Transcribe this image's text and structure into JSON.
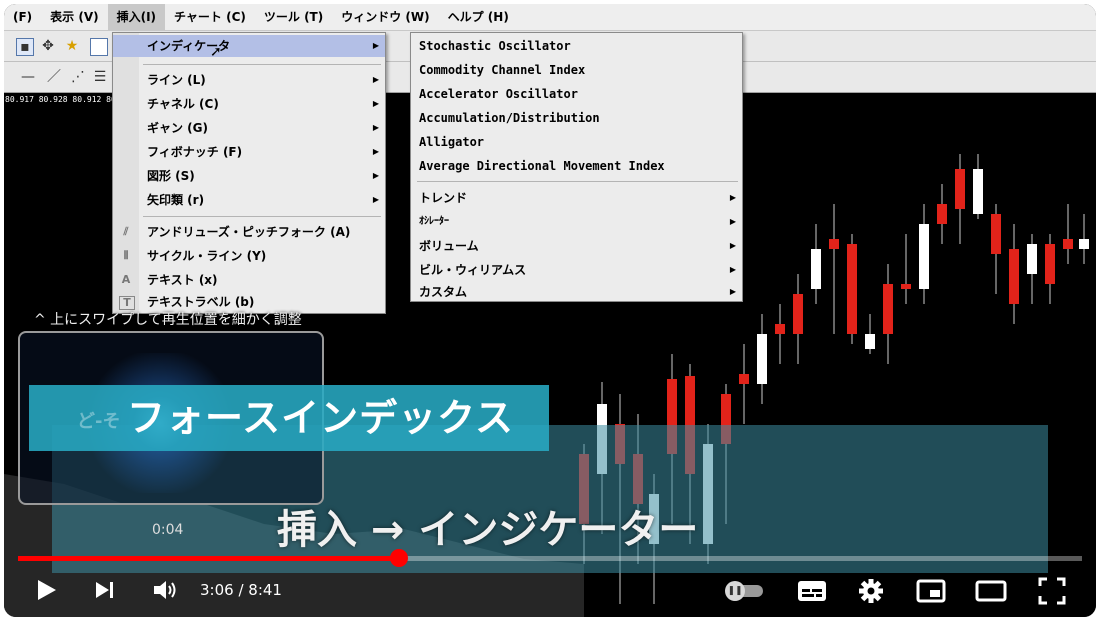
{
  "menubar": {
    "items": [
      "(F)",
      "表示 (V)",
      "挿入(I)",
      "チャート (C)",
      "ツール (T)",
      "ウィンドウ (W)",
      "ヘルプ (H)"
    ],
    "active_index": 2
  },
  "price_header": "80.917 80.928 80.912 80",
  "insert_menu": {
    "indicator": "インディケータ",
    "items": [
      {
        "label": "ライン (L)",
        "icon": ""
      },
      {
        "label": "チャネル (C)",
        "icon": ""
      },
      {
        "label": "ギャン (G)",
        "icon": ""
      },
      {
        "label": "フィボナッチ (F)",
        "icon": ""
      },
      {
        "label": "図形 (S)",
        "icon": ""
      },
      {
        "label": "矢印類 (r)",
        "icon": ""
      }
    ],
    "tools": [
      {
        "label": "アンドリューズ・ピッチフォーク (A)",
        "icon": "pitchfork-icon"
      },
      {
        "label": "サイクル・ライン (Y)",
        "icon": "cycle-lines-icon"
      },
      {
        "label": "テキスト (x)",
        "icon": "text-icon"
      },
      {
        "label": "テキストラベル (b)",
        "icon": "text-label-icon"
      }
    ]
  },
  "indicator_menu": {
    "items": [
      "Stochastic Oscillator",
      "Commodity Channel Index",
      "Accelerator Oscillator",
      "Accumulation/Distribution",
      "Alligator",
      "Average Directional Movement Index"
    ],
    "submenus": [
      "トレンド",
      "ｵｼﾚｰﾀｰ",
      "ボリューム",
      "ビル・ウィリアムス",
      "カスタム"
    ]
  },
  "overlay": {
    "swipe_hint": "^ 上にスワイプして再生位置を細かく調整",
    "preview_time": "0:04",
    "banner_title": "フォースインデックス",
    "banner_faint": "ど-そ",
    "caption": "挿入 → インジケーター"
  },
  "player": {
    "current_time": "3:06",
    "separator": " / ",
    "duration": "8:41",
    "progress": 0.358,
    "icons": [
      "play-icon",
      "next-icon",
      "volume-icon",
      "autoplay-pause-icon",
      "subtitles-icon",
      "settings-gear-icon",
      "miniplayer-icon",
      "theater-mode-icon",
      "fullscreen-icon"
    ]
  },
  "colors": {
    "bull": "#ffffff",
    "bear": "#e2231a",
    "menu_highlight": "#b3bfe6",
    "progress": "#ff0000",
    "banner": "#28aac3"
  }
}
